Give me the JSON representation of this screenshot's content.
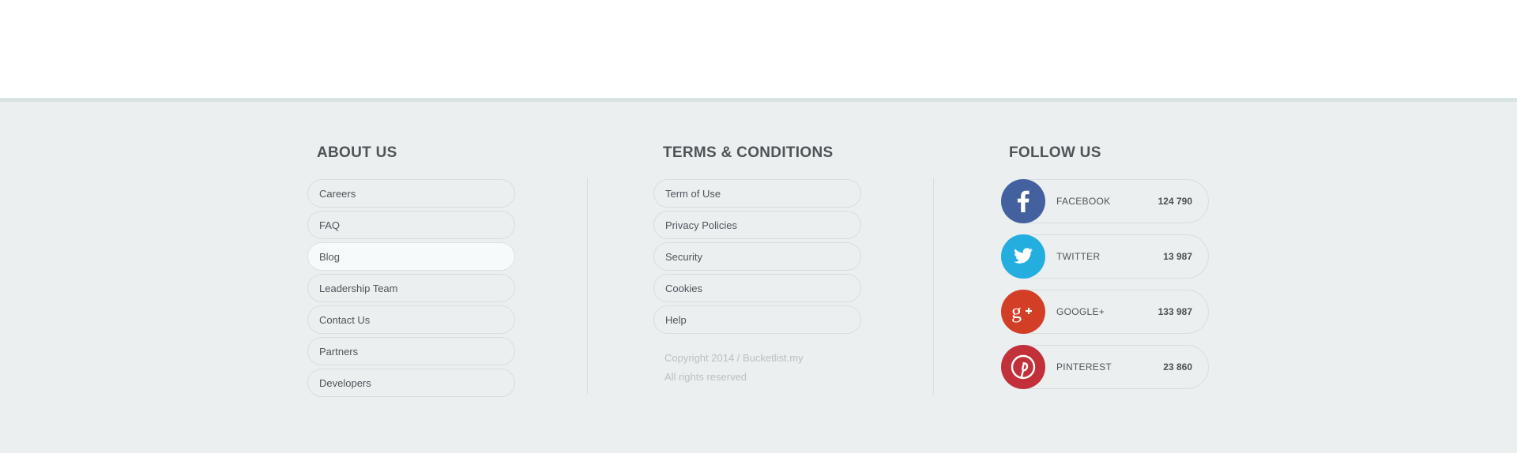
{
  "about": {
    "title": "ABOUT US",
    "items": [
      "Careers",
      "FAQ",
      "Blog",
      "Leadership Team",
      "Contact Us",
      "Partners",
      "Developers"
    ]
  },
  "terms": {
    "title": "TERMS & CONDITIONS",
    "items": [
      "Term of Use",
      "Privacy Policies",
      "Security",
      "Cookies",
      "Help"
    ],
    "copyright_line1": "Copyright 2014 / Bucketlist.my",
    "copyright_line2": "All rights reserved"
  },
  "follow": {
    "title": "FOLLOW US",
    "networks": [
      {
        "name": "FACEBOOK",
        "count": "124 790",
        "color": "#3b5998",
        "icon": "facebook-icon"
      },
      {
        "name": "TWITTER",
        "count": "13 987",
        "color": "#1faee1",
        "icon": "twitter-icon"
      },
      {
        "name": "GOOGLE+",
        "count": "133 987",
        "color": "#d73d25",
        "icon": "google-plus-icon"
      },
      {
        "name": "PINTEREST",
        "count": "23 860",
        "color": "#c2272d",
        "icon": "pinterest-icon"
      }
    ]
  },
  "colors": {
    "footer_bg": "#ebeff0",
    "footer_top_border": "#d7e2e3",
    "title_text": "#4d5357",
    "body_text": "#4e555a",
    "muted_text": "#b9c0c4"
  }
}
